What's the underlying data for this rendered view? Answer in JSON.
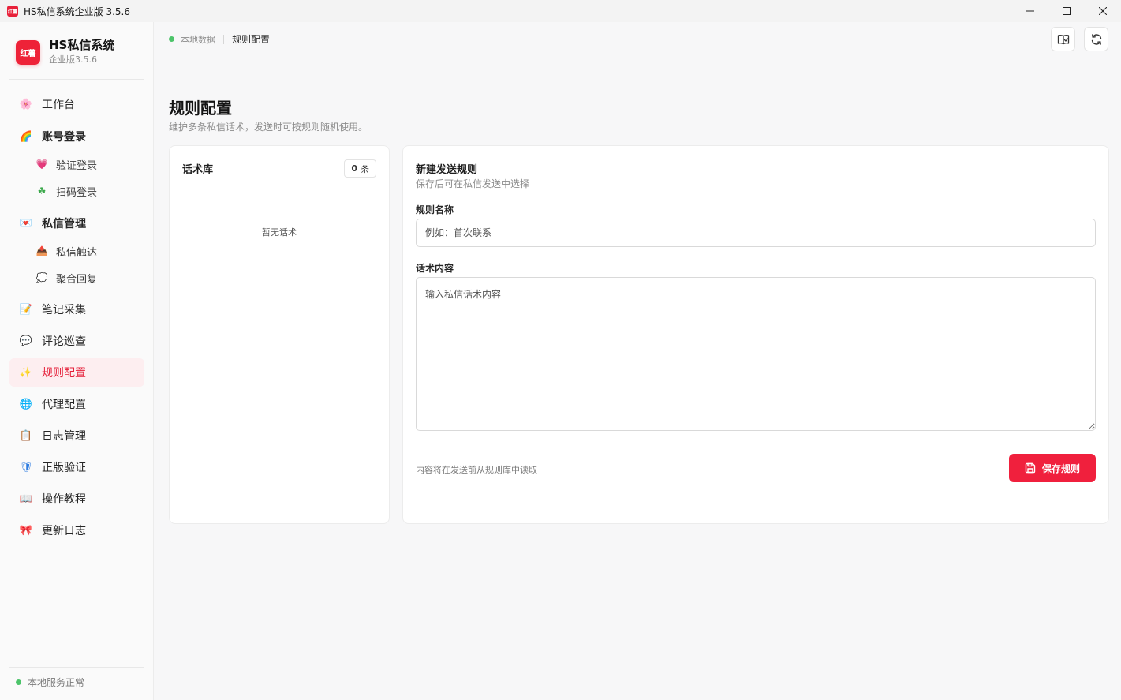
{
  "window": {
    "title": "HS私信系统企业版 3.5.6",
    "app_icon_text": "红薯",
    "controls": [
      "minimize-icon",
      "maximize-icon",
      "close-icon"
    ]
  },
  "sidebar": {
    "brand_name": "HS私信系统",
    "brand_logo_text": "红薯",
    "brand_version": "企业版3.5.6",
    "items": [
      {
        "label": "工作台",
        "icon": "🌸"
      },
      {
        "label": "账号登录",
        "icon": "🌈"
      },
      {
        "label": "验证登录",
        "icon": "💗"
      },
      {
        "label": "扫码登录",
        "icon": "☘"
      },
      {
        "label": "私信管理",
        "icon": "💌"
      },
      {
        "label": "私信触达",
        "icon": "📤"
      },
      {
        "label": "聚合回复",
        "icon": "💭"
      },
      {
        "label": "笔记采集",
        "icon": "📝"
      },
      {
        "label": "评论巡查",
        "icon": "💬"
      },
      {
        "label": "规则配置",
        "icon": "✨"
      },
      {
        "label": "代理配置",
        "icon": "🌐"
      },
      {
        "label": "日志管理",
        "icon": "📋"
      },
      {
        "label": "正版验证",
        "icon": "🛡"
      },
      {
        "label": "操作教程",
        "icon": "📖"
      },
      {
        "label": "更新日志",
        "icon": "🎀"
      }
    ],
    "active_item": "规则配置",
    "status_text": "本地服务正常",
    "status_color": "#4cc46a"
  },
  "header": {
    "breadcrumb_root": "本地数据",
    "breadcrumb_current": "规则配置"
  },
  "page": {
    "title": "规则配置",
    "description": "维护多条私信话术，发送时可按规则随机使用。"
  },
  "library": {
    "title": "话术库",
    "count": "0",
    "count_unit": "条",
    "empty_text": "暂无话术"
  },
  "form": {
    "title": "新建发送规则",
    "subtitle": "保存后可在私信发送中选择",
    "name_label": "规则名称",
    "name_placeholder": "例如：首次联系",
    "name_value": "",
    "content_label": "话术内容",
    "content_placeholder": "输入私信话术内容",
    "content_value": "",
    "hint": "内容将在发送前从规则库中读取",
    "save_label": "保存规则"
  },
  "colors": {
    "accent": "#f0203d",
    "active_bg": "#fdeef0"
  }
}
